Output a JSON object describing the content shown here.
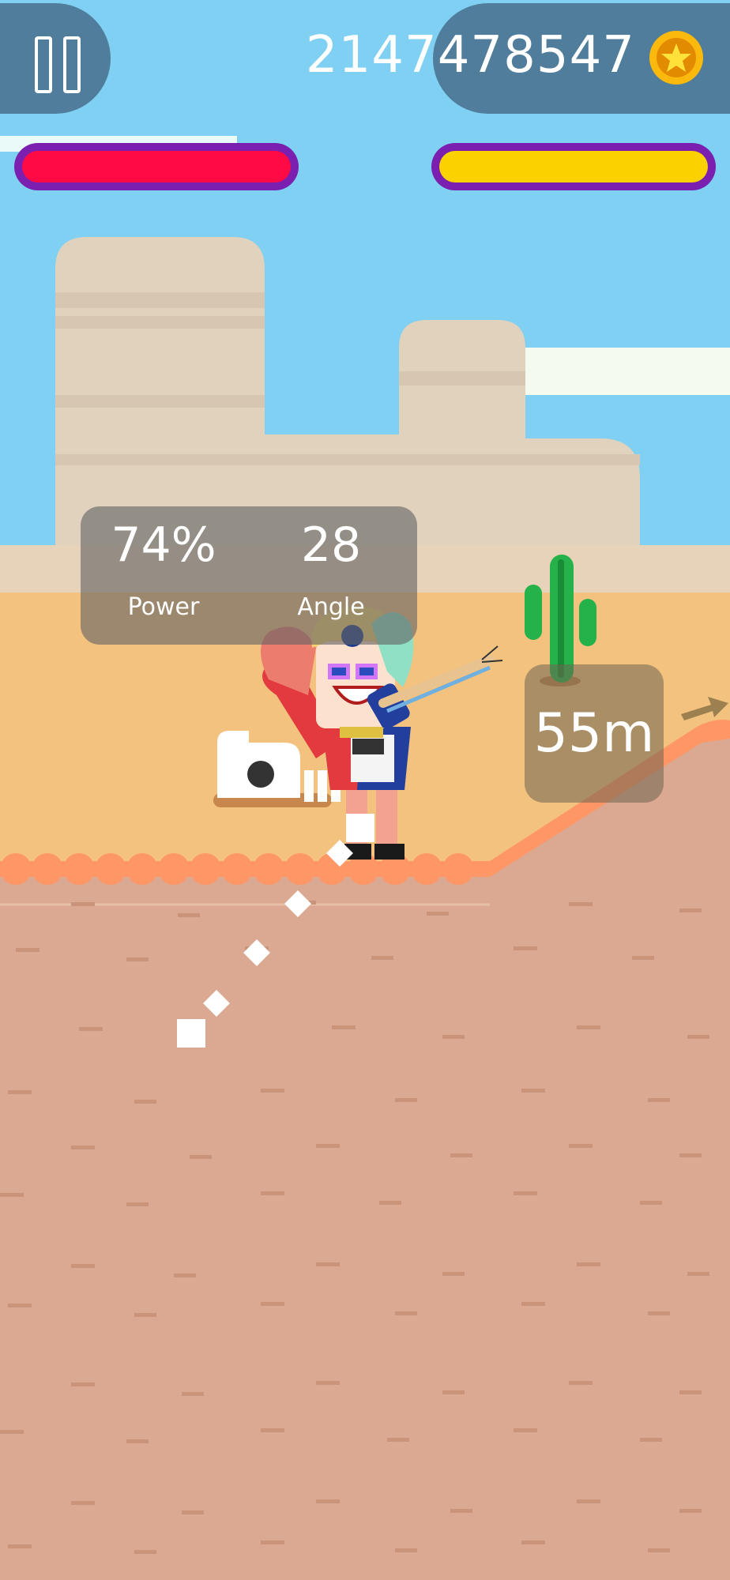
{
  "hud": {
    "coins": "2147478547",
    "player_health": 1.0,
    "enemy_health": 1.0
  },
  "aim": {
    "power": "74%",
    "power_label": "Power",
    "angle": "28",
    "angle_label": "Angle"
  },
  "distance": "55m",
  "icons": {
    "pause": "pause-icon",
    "coin": "star-coin-icon",
    "arrow": "arrow-right-icon"
  },
  "colors": {
    "sky": "#7fd0f2",
    "player_bar": "#ff0a45",
    "enemy_bar": "#fbd200",
    "bar_border": "#7a1fb0",
    "ground": "#dba991",
    "ground_edge": "#ff9666"
  }
}
